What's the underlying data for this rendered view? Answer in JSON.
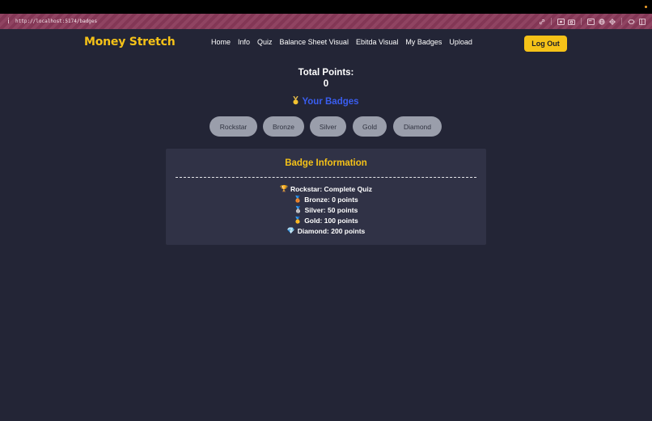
{
  "browser": {
    "url": "http://localhost:5174/badges",
    "icons": [
      "link-icon",
      "screenshot-icon",
      "camera-icon",
      "reader-icon",
      "globe-icon",
      "crosshair-icon",
      "extensions-icon",
      "sidebar-icon"
    ]
  },
  "nav": {
    "brand": "Money Stretch",
    "links": [
      "Home",
      "Info",
      "Quiz",
      "Balance Sheet Visual",
      "Ebitda Visual",
      "My Badges",
      "Upload"
    ],
    "logout_label": "Log Out"
  },
  "points": {
    "title": "Total Points:",
    "value": "0"
  },
  "badges": {
    "heading": "Your Badges",
    "items": [
      "Rockstar",
      "Bronze",
      "Silver",
      "Gold",
      "Diamond"
    ]
  },
  "info": {
    "title": "Badge Information",
    "lines": [
      {
        "icon": "🏆",
        "text": "Rockstar: Complete Quiz"
      },
      {
        "icon": "🥉",
        "text": "Bronze: 0 points"
      },
      {
        "icon": "🥈",
        "text": "Silver: 50 points"
      },
      {
        "icon": "🥇",
        "text": "Gold: 100 points"
      },
      {
        "icon": "💎",
        "text": "Diamond: 200 points"
      }
    ]
  },
  "colors": {
    "background": "#232536",
    "accent": "#f5c218",
    "heading_blue": "#3a5ef0",
    "card": "#303246",
    "badge": "#9a9eab"
  }
}
